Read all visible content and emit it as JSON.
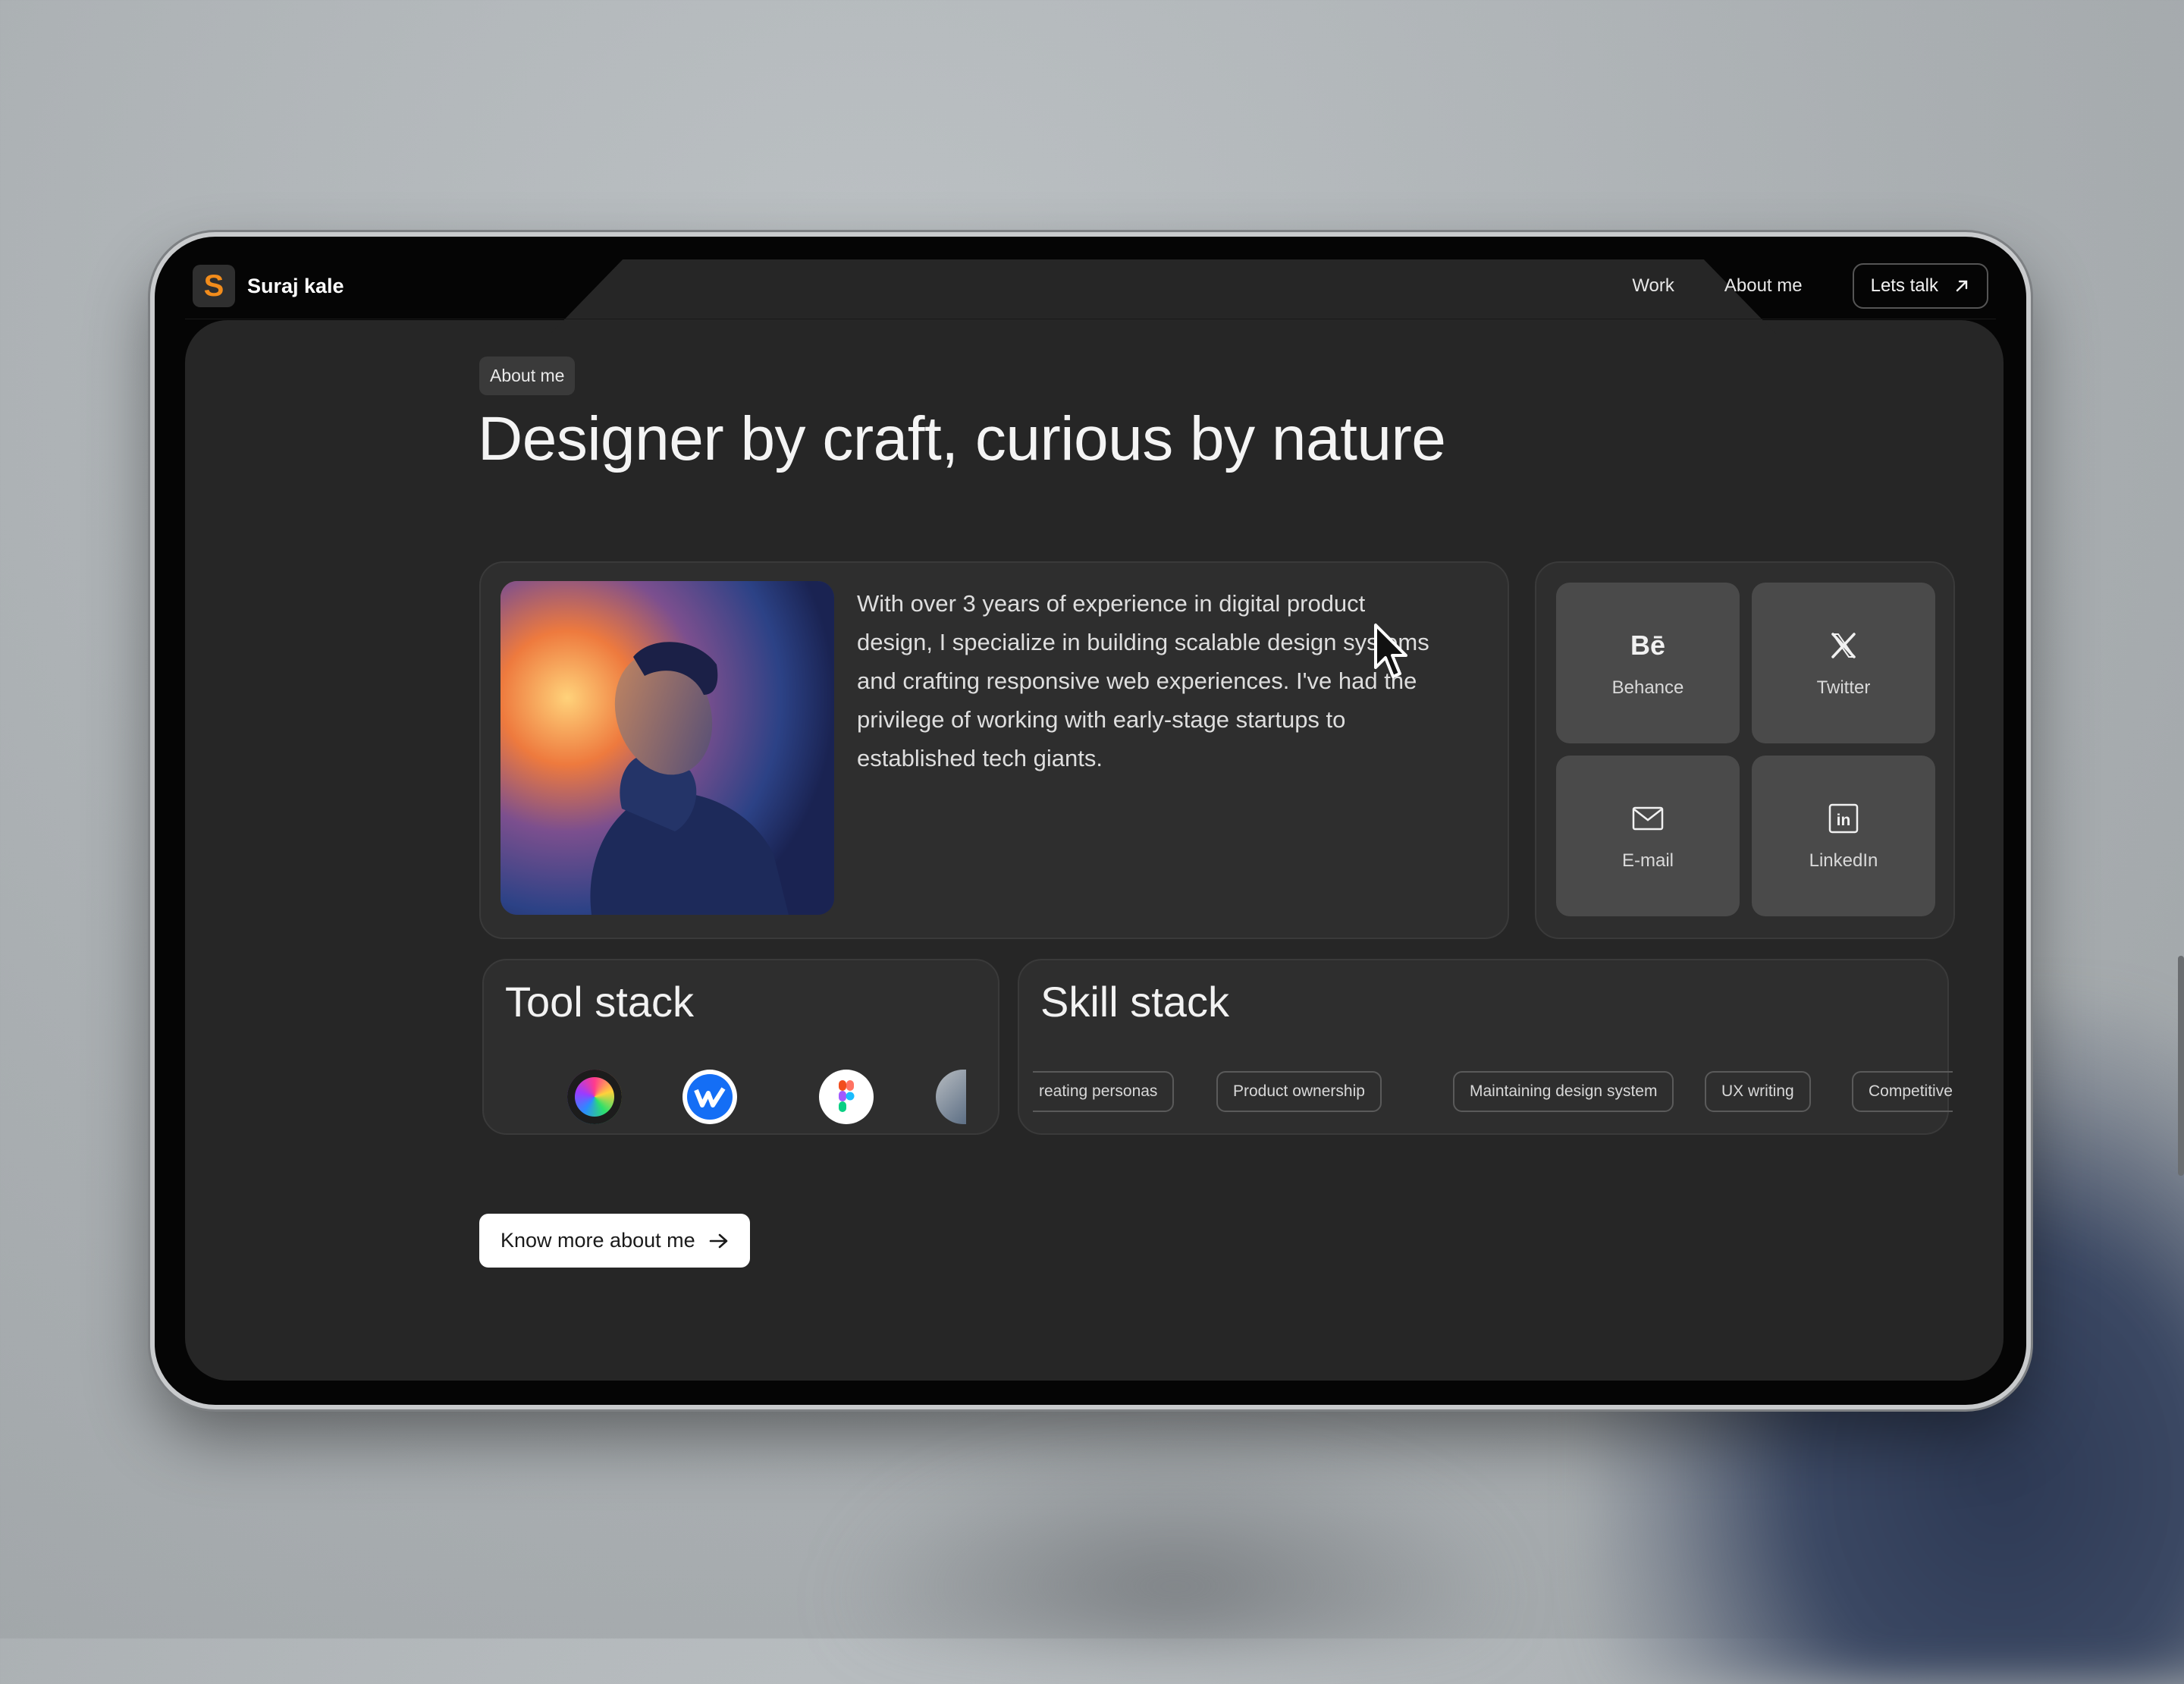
{
  "nav": {
    "logo_letter": "S",
    "logo_name": "Suraj kale",
    "links": [
      "Work",
      "About me"
    ],
    "cta_label": "Lets talk"
  },
  "about": {
    "tag": "About me",
    "headline": "Designer by craft, curious by nature",
    "bio": "With over 3 years of experience in digital product design, I specialize in building scalable design systems and crafting responsive web experiences. I've had the privilege of working with early-stage startups to established tech giants."
  },
  "social": {
    "behance": {
      "label": "Behance",
      "icon": "behance-icon",
      "glyph": "Bē"
    },
    "twitter": {
      "label": "Twitter",
      "icon": "x-icon",
      "glyph": "𝕏"
    },
    "email": {
      "label": "E-mail",
      "icon": "mail-icon"
    },
    "linkedin": {
      "label": "LinkedIn",
      "icon": "linkedin-icon",
      "glyph": "in"
    }
  },
  "tools": {
    "title": "Tool stack",
    "items": [
      "spline-like-icon",
      "webflow-icon",
      "figma-icon",
      "framer-icon"
    ]
  },
  "skills": {
    "title": "Skill stack",
    "items": [
      "reating personas",
      "Product ownership",
      "Maintaining design system",
      "UX writing",
      "Competitive"
    ]
  },
  "cta": {
    "label": "Know more about me"
  },
  "colors": {
    "accent": "#f28c1b",
    "screen_bg": "#262626",
    "card_bg": "#2e2e2e"
  }
}
